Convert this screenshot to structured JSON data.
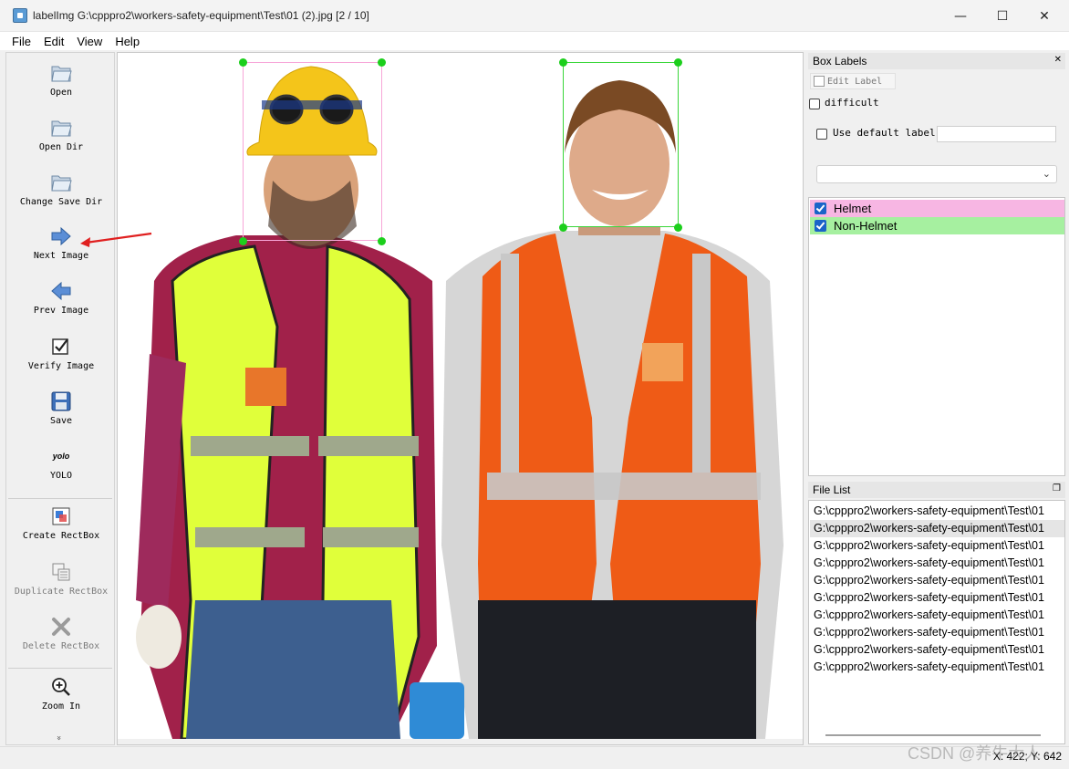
{
  "window": {
    "title": "labelImg G:\\cpppro2\\workers-safety-equipment\\Test\\01 (2).jpg [2 / 10]",
    "minimize": "—",
    "maximize": "☐",
    "close": "✕"
  },
  "menu": [
    "File",
    "Edit",
    "View",
    "Help"
  ],
  "toolbar": {
    "open": "Open",
    "open_dir": "Open Dir",
    "change_save_dir": "Change Save Dir",
    "next_image": "Next Image",
    "prev_image": "Prev Image",
    "verify_image": "Verify Image",
    "save": "Save",
    "yolo_icon_text": "yolo",
    "yolo": "YOLO",
    "create_rectbox": "Create RectBox",
    "duplicate_rectbox": "Duplicate RectBox",
    "delete_rectbox": "Delete RectBox",
    "zoom_in": "Zoom In",
    "more": "»"
  },
  "box_labels": {
    "title": "Box Labels",
    "edit_label": "Edit Label",
    "difficult": "difficult",
    "use_default_label": "Use default label",
    "default_label_value": "",
    "labels": [
      {
        "name": "Helmet",
        "color": "#f7b6e3",
        "checked": true
      },
      {
        "name": "Non-Helmet",
        "color": "#a6f0a0",
        "checked": true
      }
    ]
  },
  "file_list": {
    "title": "File List",
    "selected_index": 1,
    "files": [
      "G:\\cpppro2\\workers-safety-equipment\\Test\\01",
      "G:\\cpppro2\\workers-safety-equipment\\Test\\01",
      "G:\\cpppro2\\workers-safety-equipment\\Test\\01",
      "G:\\cpppro2\\workers-safety-equipment\\Test\\01",
      "G:\\cpppro2\\workers-safety-equipment\\Test\\01",
      "G:\\cpppro2\\workers-safety-equipment\\Test\\01",
      "G:\\cpppro2\\workers-safety-equipment\\Test\\01",
      "G:\\cpppro2\\workers-safety-equipment\\Test\\01",
      "G:\\cpppro2\\workers-safety-equipment\\Test\\01",
      "G:\\cpppro2\\workers-safety-equipment\\Test\\01"
    ]
  },
  "status": {
    "coords": "X: 422; Y: 642"
  },
  "watermark": "CSDN @养牛大人",
  "colors": {
    "helmet_box": "#f7a6d8",
    "non_helmet_box": "#39d639",
    "handle": "#1ccf1c",
    "annotation_arrow": "#e02020"
  }
}
